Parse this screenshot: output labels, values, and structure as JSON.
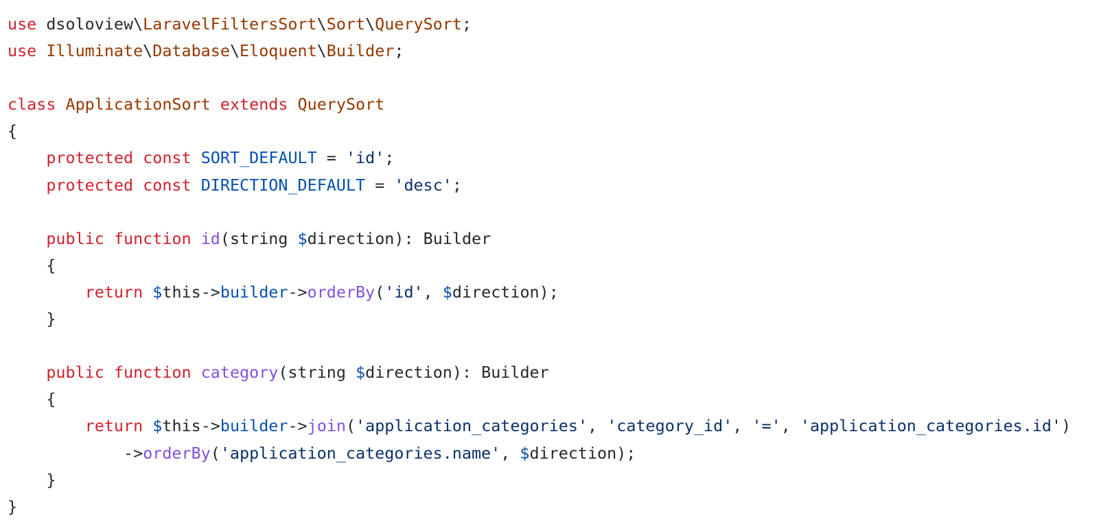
{
  "code": {
    "language": "php",
    "colors": {
      "keyword": "#cf222e",
      "class": "#953800",
      "constant": "#0550ae",
      "function": "#8250df",
      "string": "#0a3069",
      "variable": "#0550ae",
      "plain": "#24292e"
    },
    "lines": [
      [
        [
          "kw",
          "use"
        ],
        [
          "plain",
          " dsoloview\\"
        ],
        [
          "cls",
          "LaravelFiltersSort"
        ],
        [
          "plain",
          "\\"
        ],
        [
          "cls",
          "Sort"
        ],
        [
          "plain",
          "\\"
        ],
        [
          "cls",
          "QuerySort"
        ],
        [
          "plain",
          ";"
        ]
      ],
      [
        [
          "kw",
          "use"
        ],
        [
          "plain",
          " "
        ],
        [
          "cls",
          "Illuminate"
        ],
        [
          "plain",
          "\\"
        ],
        [
          "cls",
          "Database"
        ],
        [
          "plain",
          "\\"
        ],
        [
          "cls",
          "Eloquent"
        ],
        [
          "plain",
          "\\"
        ],
        [
          "cls",
          "Builder"
        ],
        [
          "plain",
          ";"
        ]
      ],
      [],
      [
        [
          "kw",
          "class"
        ],
        [
          "plain",
          " "
        ],
        [
          "cls",
          "ApplicationSort"
        ],
        [
          "plain",
          " "
        ],
        [
          "kw",
          "extends"
        ],
        [
          "plain",
          " "
        ],
        [
          "cls",
          "QuerySort"
        ]
      ],
      [
        [
          "plain",
          "{"
        ]
      ],
      [
        [
          "plain",
          "    "
        ],
        [
          "kw",
          "protected"
        ],
        [
          "plain",
          " "
        ],
        [
          "kw",
          "const"
        ],
        [
          "plain",
          " "
        ],
        [
          "const",
          "SORT_DEFAULT"
        ],
        [
          "plain",
          " = "
        ],
        [
          "str",
          "'id'"
        ],
        [
          "plain",
          ";"
        ]
      ],
      [
        [
          "plain",
          "    "
        ],
        [
          "kw",
          "protected"
        ],
        [
          "plain",
          " "
        ],
        [
          "kw",
          "const"
        ],
        [
          "plain",
          " "
        ],
        [
          "const",
          "DIRECTION_DEFAULT"
        ],
        [
          "plain",
          " = "
        ],
        [
          "str",
          "'desc'"
        ],
        [
          "plain",
          ";"
        ]
      ],
      [],
      [
        [
          "plain",
          "    "
        ],
        [
          "kw",
          "public"
        ],
        [
          "plain",
          " "
        ],
        [
          "kw",
          "function"
        ],
        [
          "plain",
          " "
        ],
        [
          "fn",
          "id"
        ],
        [
          "plain",
          "(string "
        ],
        [
          "var",
          "$"
        ],
        [
          "plain",
          "direction): Builder"
        ]
      ],
      [
        [
          "plain",
          "    {"
        ]
      ],
      [
        [
          "plain",
          "        "
        ],
        [
          "kw",
          "return"
        ],
        [
          "plain",
          " "
        ],
        [
          "var",
          "$"
        ],
        [
          "plain",
          "this->"
        ],
        [
          "var",
          "builder"
        ],
        [
          "plain",
          "->"
        ],
        [
          "fn",
          "orderBy"
        ],
        [
          "plain",
          "("
        ],
        [
          "str",
          "'id'"
        ],
        [
          "plain",
          ", "
        ],
        [
          "var",
          "$"
        ],
        [
          "plain",
          "direction);"
        ]
      ],
      [
        [
          "plain",
          "    }"
        ]
      ],
      [],
      [
        [
          "plain",
          "    "
        ],
        [
          "kw",
          "public"
        ],
        [
          "plain",
          " "
        ],
        [
          "kw",
          "function"
        ],
        [
          "plain",
          " "
        ],
        [
          "fn",
          "category"
        ],
        [
          "plain",
          "(string "
        ],
        [
          "var",
          "$"
        ],
        [
          "plain",
          "direction): Builder"
        ]
      ],
      [
        [
          "plain",
          "    {"
        ]
      ],
      [
        [
          "plain",
          "        "
        ],
        [
          "kw",
          "return"
        ],
        [
          "plain",
          " "
        ],
        [
          "var",
          "$"
        ],
        [
          "plain",
          "this->"
        ],
        [
          "var",
          "builder"
        ],
        [
          "plain",
          "->"
        ],
        [
          "fn",
          "join"
        ],
        [
          "plain",
          "("
        ],
        [
          "str",
          "'application_categories'"
        ],
        [
          "plain",
          ", "
        ],
        [
          "str",
          "'category_id'"
        ],
        [
          "plain",
          ", "
        ],
        [
          "str",
          "'='"
        ],
        [
          "plain",
          ", "
        ],
        [
          "str",
          "'application_categories.id'"
        ],
        [
          "plain",
          ")"
        ]
      ],
      [
        [
          "plain",
          "            ->"
        ],
        [
          "fn",
          "orderBy"
        ],
        [
          "plain",
          "("
        ],
        [
          "str",
          "'application_categories.name'"
        ],
        [
          "plain",
          ", "
        ],
        [
          "var",
          "$"
        ],
        [
          "plain",
          "direction);"
        ]
      ],
      [
        [
          "plain",
          "    }"
        ]
      ],
      [
        [
          "plain",
          "}"
        ]
      ]
    ]
  }
}
